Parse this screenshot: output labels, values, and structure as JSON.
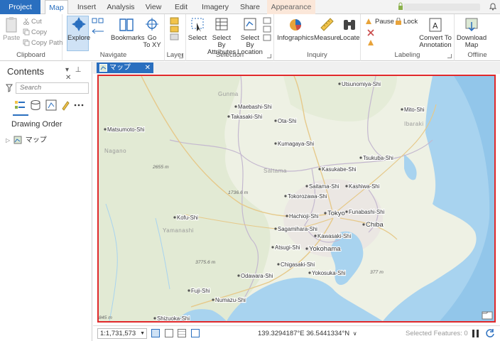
{
  "tabs": {
    "project": "Project",
    "map": "Map",
    "insert": "Insert",
    "analysis": "Analysis",
    "view": "View",
    "edit": "Edit",
    "imagery": "Imagery",
    "share": "Share",
    "appearance": "Appearance"
  },
  "ribbon": {
    "clipboard": {
      "label": "Clipboard",
      "paste": "Paste",
      "cut": "Cut",
      "copy": "Copy",
      "copy_path": "Copy Path"
    },
    "navigate": {
      "label": "Navigate",
      "explore": "Explore",
      "bookmarks": "Bookmarks",
      "goto_line1": "Go",
      "goto_line2": "To XY"
    },
    "layer": {
      "label": "Layer"
    },
    "selection": {
      "label": "Selection",
      "select": "Select",
      "select_by_attr_1": "Select By",
      "select_by_attr_2": "Attributes",
      "select_by_loc_1": "Select By",
      "select_by_loc_2": "Location"
    },
    "inquiry": {
      "label": "Inquiry",
      "infographics": "Infographics",
      "measure": "Measure",
      "locate": "Locate"
    },
    "labeling": {
      "label": "Labeling",
      "pause": "Pause",
      "lock": "Lock",
      "convert_1": "Convert To",
      "convert_2": "Annotation"
    },
    "offline": {
      "label": "Offline",
      "download_1": "Download",
      "download_2": "Map"
    }
  },
  "contents": {
    "title": "Contents",
    "search_placeholder": "Search",
    "drawing_order": "Drawing Order",
    "layer_name": "マップ"
  },
  "map_tab": {
    "label": "マップ"
  },
  "map": {
    "cities": [
      {
        "name": "Utsunomiya-Shi"
      },
      {
        "name": "Maebashi-Shi"
      },
      {
        "name": "Takasaki-Shi"
      },
      {
        "name": "Ota-Shi"
      },
      {
        "name": "Mito-Shi"
      },
      {
        "name": "Matsumoto-Shi"
      },
      {
        "name": "Kumagaya-Shi"
      },
      {
        "name": "Tsukuba-Shi"
      },
      {
        "name": "Kasukabe-Shi"
      },
      {
        "name": "Saitama-Shi"
      },
      {
        "name": "Kashiwa-Shi"
      },
      {
        "name": "Tokorozawa-Shi"
      },
      {
        "name": "Kofu-Shi"
      },
      {
        "name": "Hachioji-Shi"
      },
      {
        "name": "Tokyo"
      },
      {
        "name": "Funabashi-Shi"
      },
      {
        "name": "Chiba"
      },
      {
        "name": "Sagamihara-Shi"
      },
      {
        "name": "Kawasaki-Shi"
      },
      {
        "name": "Atsugi-Shi"
      },
      {
        "name": "Yokohama"
      },
      {
        "name": "Chigasaki-Shi"
      },
      {
        "name": "Yokosuka-Shi"
      },
      {
        "name": "Odawara-Shi"
      },
      {
        "name": "Fuji-Shi"
      },
      {
        "name": "Numazu-Shi"
      },
      {
        "name": "Shizuoka-Shi"
      }
    ],
    "regions": [
      {
        "name": "Gunma"
      },
      {
        "name": "Ibaraki"
      },
      {
        "name": "Nagano"
      },
      {
        "name": "Saitama"
      },
      {
        "name": "Yamanashi"
      }
    ],
    "elevations": [
      {
        "name": "2655 m"
      },
      {
        "name": "1736.6 m"
      },
      {
        "name": "3775.6 m"
      },
      {
        "name": "377 m"
      },
      {
        "name": "845 m"
      }
    ]
  },
  "status": {
    "scale": "1:1,731,573",
    "coords": "139.3294187°E 36.5441334°N",
    "selected": "Selected Features: 0"
  }
}
